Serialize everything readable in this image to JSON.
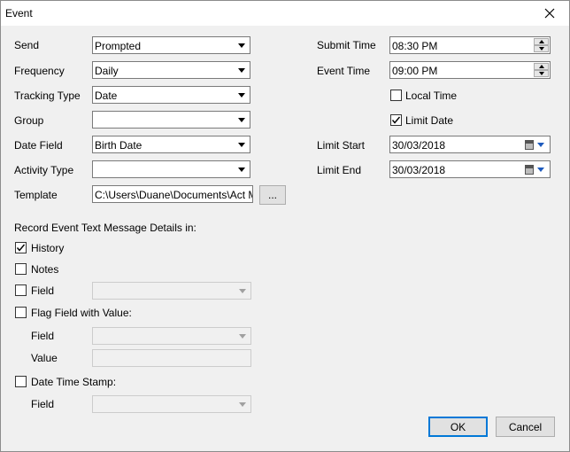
{
  "window": {
    "title": "Event"
  },
  "left": {
    "send": {
      "label": "Send",
      "value": "Prompted"
    },
    "frequency": {
      "label": "Frequency",
      "value": "Daily"
    },
    "tracking_type": {
      "label": "Tracking Type",
      "value": "Date"
    },
    "group": {
      "label": "Group",
      "value": ""
    },
    "date_field": {
      "label": "Date Field",
      "value": "Birth Date"
    },
    "activity_type": {
      "label": "Activity Type",
      "value": ""
    },
    "template": {
      "label": "Template",
      "value": "C:\\Users\\Duane\\Documents\\Act Mc",
      "browse_label": "..."
    }
  },
  "right": {
    "submit_time": {
      "label": "Submit Time",
      "value": "08:30 PM"
    },
    "event_time": {
      "label": "Event Time",
      "value": "09:00 PM"
    },
    "local_time": {
      "label": "Local Time",
      "checked": false
    },
    "limit_date": {
      "label": "Limit Date",
      "checked": true
    },
    "limit_start": {
      "label": "Limit Start",
      "value": "30/03/2018"
    },
    "limit_end": {
      "label": "Limit End",
      "value": "30/03/2018"
    }
  },
  "record": {
    "heading": "Record Event Text Message Details in:",
    "history": {
      "label": "History",
      "checked": true
    },
    "notes": {
      "label": "Notes",
      "checked": false
    },
    "field": {
      "label": "Field",
      "checked": false,
      "value": ""
    },
    "flag_field": {
      "label": "Flag Field with Value:",
      "checked": false
    },
    "flag_field_field": {
      "label": "Field",
      "value": ""
    },
    "flag_field_value": {
      "label": "Value",
      "value": ""
    },
    "date_time_stamp": {
      "label": "Date Time Stamp:",
      "checked": false
    },
    "stamp_field": {
      "label": "Field",
      "value": ""
    }
  },
  "buttons": {
    "ok": "OK",
    "cancel": "Cancel"
  }
}
